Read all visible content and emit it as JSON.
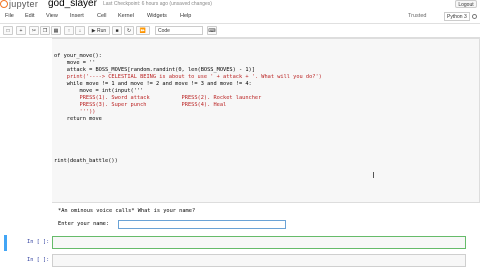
{
  "header": {
    "brand": "jupyter",
    "notebook_name": "god_slayer",
    "checkpoint": "Last Checkpoint: 6 hours ago (unsaved changes)",
    "logout": "Logout"
  },
  "menu": {
    "items": [
      "File",
      "Edit",
      "View",
      "Insert",
      "Cell",
      "Kernel",
      "Widgets",
      "Help"
    ],
    "trusted": "Trusted",
    "kernel": "Python 3"
  },
  "toolbar": {
    "run_label": "▶ Run",
    "cell_type": "Code"
  },
  "code_lines": [
    "of your_move():",
    "    move = ''",
    "    attack = BOSS_MOVES[random.randint(0, len(BOSS_MOVES) - 1)]",
    "    print('----> CELESTIAL BEING is about to use ' + attack + '. What will you do?')",
    "    while move != 1 and move != 2 and move != 3 and move != 4:",
    "        move = int(input('''",
    "        PRESS(1). Sword attack          PRESS(2). Rocket launcher",
    "        PRESS(3). Super punch           PRESS(4). Heal",
    "        '''))",
    "    return move",
    "",
    "",
    "",
    "",
    "rint(death_battle())"
  ],
  "output": {
    "line1": "*An ominous voice calls* What is your name?",
    "line2": "Enter your name:"
  },
  "cells": [
    {
      "prompt": "In [ ]:"
    },
    {
      "prompt": "In [ ]:"
    }
  ]
}
